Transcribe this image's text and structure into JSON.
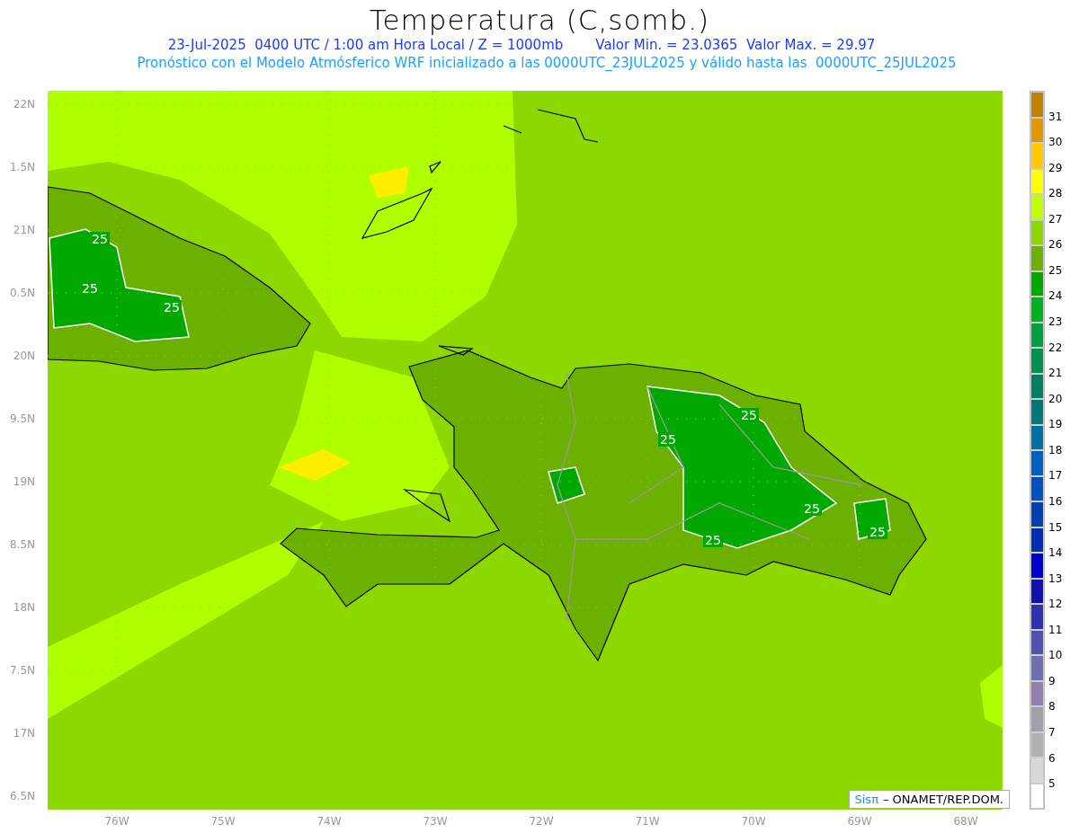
{
  "title": "Temperatura (C,somb.)",
  "subtitle_line_1": {
    "left": "23-Jul-2025  0400 UTC / 1:00 am Hora Local / Z = 1000mb",
    "right": "Valor Min. = 23.0365  Valor Max. = 29.97"
  },
  "subtitle_line_2": "Pronóstico con el Modelo Atmósferico WRF inicializado a las 0000UTC_23JUL2025 y válido hasta las  0000UTC_25JUL2025",
  "y_axis_labels": [
    "22N",
    "1.5N",
    "21N",
    "0.5N",
    "20N",
    "9.5N",
    "19N",
    "8.5N",
    "18N",
    "7.5N",
    "17N",
    "6.5N"
  ],
  "x_axis_labels": [
    "76W",
    "75W",
    "74W",
    "73W",
    "72W",
    "71W",
    "70W",
    "69W",
    "68W"
  ],
  "contour_labels": [
    {
      "text": "25"
    },
    {
      "text": "25"
    },
    {
      "text": "25"
    },
    {
      "text": "25"
    },
    {
      "text": "25"
    },
    {
      "text": "25"
    },
    {
      "text": "25"
    },
    {
      "text": "25"
    }
  ],
  "credit": {
    "brand": "Sisπ",
    "text": "– ONAMET/REP.DOM."
  },
  "colorbar": {
    "labels": [
      "31",
      "30",
      "29",
      "28",
      "27",
      "26",
      "25",
      "24",
      "23",
      "22",
      "21",
      "20",
      "19",
      "18",
      "17",
      "16",
      "15",
      "14",
      "13",
      "12",
      "11",
      "10",
      "9",
      "8",
      "7",
      "6",
      "5"
    ],
    "bins": [
      {
        "color": "#c08000"
      },
      {
        "color": "#e09800"
      },
      {
        "color": "#ffc800"
      },
      {
        "color": "#ffff00"
      },
      {
        "color": "#c0ff00"
      },
      {
        "color": "#8cd800"
      },
      {
        "color": "#6cb000"
      },
      {
        "color": "#00a800"
      },
      {
        "color": "#00b020"
      },
      {
        "color": "#00a040"
      },
      {
        "color": "#009050"
      },
      {
        "color": "#008060"
      },
      {
        "color": "#007878"
      },
      {
        "color": "#0070a0"
      },
      {
        "color": "#0060c0"
      },
      {
        "color": "#0050c0"
      },
      {
        "color": "#0040b0"
      },
      {
        "color": "#0030b0"
      },
      {
        "color": "#0000c8"
      },
      {
        "color": "#1010b0"
      },
      {
        "color": "#3030b0"
      },
      {
        "color": "#5050b0"
      },
      {
        "color": "#7070b0"
      },
      {
        "color": "#9080b0"
      },
      {
        "color": "#a0a0a8"
      },
      {
        "color": "#b0b0b0"
      },
      {
        "color": "#d8d8d8"
      },
      {
        "color": "#ffffff"
      }
    ]
  }
}
